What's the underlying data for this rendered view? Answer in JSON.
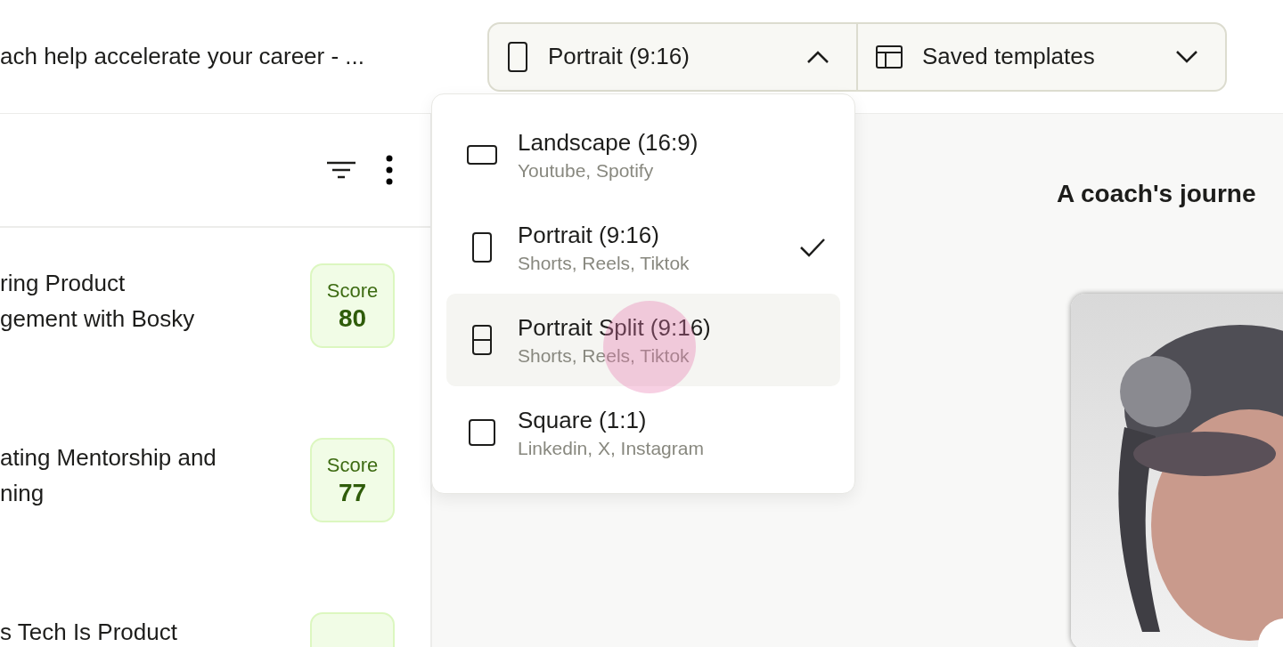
{
  "header": {
    "title": "ach help accelerate your career - ...",
    "format_select": {
      "label": "Portrait (9:16)",
      "expanded": true
    },
    "templates_select": {
      "label": "Saved templates",
      "expanded": false
    }
  },
  "format_menu": [
    {
      "kind": "landscape",
      "title": "Landscape (16:9)",
      "subtitle": "Youtube, Spotify",
      "selected": false,
      "hovered": false
    },
    {
      "kind": "portrait",
      "title": "Portrait (9:16)",
      "subtitle": "Shorts, Reels, Tiktok",
      "selected": true,
      "hovered": false
    },
    {
      "kind": "split",
      "title": "Portrait Split (9:16)",
      "subtitle": "Shorts, Reels, Tiktok",
      "selected": false,
      "hovered": true
    },
    {
      "kind": "square",
      "title": "Square (1:1)",
      "subtitle": "Linkedin, X, Instagram",
      "selected": false,
      "hovered": false
    }
  ],
  "clips": [
    {
      "title_lines": [
        "ring Product",
        "gement with Bosky"
      ],
      "score_label": "Score",
      "score": "80"
    },
    {
      "title_lines": [
        "ating Mentorship and",
        "ning"
      ],
      "score_label": "Score",
      "score": "77"
    },
    {
      "title_lines": [
        "s Tech Is Product"
      ]
    }
  ],
  "preview": {
    "title": "A coach's journe"
  }
}
